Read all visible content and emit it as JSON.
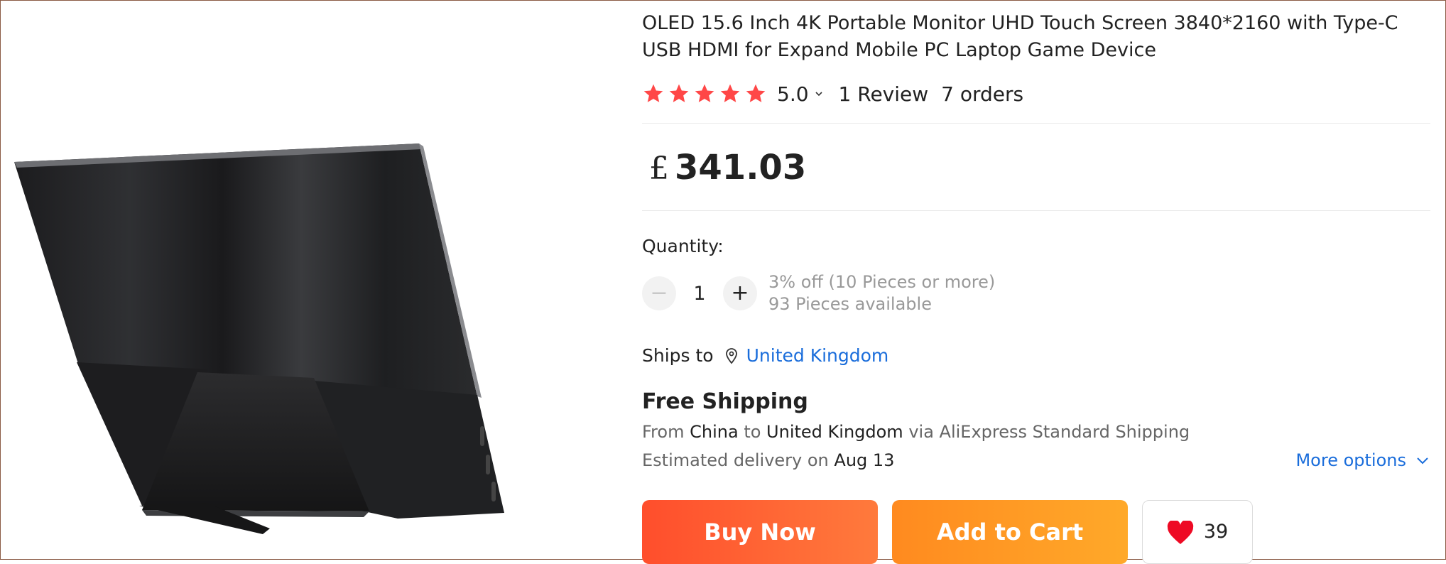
{
  "product": {
    "title": "OLED 15.6 Inch 4K Portable Monitor UHD Touch Screen 3840*2160 with Type-C USB HDMI for Expand Mobile PC Laptop Game Device",
    "image_alt": "portable monitor with kickstand"
  },
  "rating": {
    "stars": 5,
    "score": "5.0",
    "reviews": "1 Review",
    "orders": "7 orders",
    "star_color": "#ff4747"
  },
  "price": {
    "currency": "£",
    "amount": "341.03"
  },
  "quantity": {
    "label": "Quantity:",
    "value": "1",
    "minus": "−",
    "plus": "+",
    "discount": "3% off (10 Pieces or more)",
    "available": "93 Pieces available"
  },
  "ships_to": {
    "label": "Ships to",
    "country": "United Kingdom"
  },
  "shipping": {
    "title": "Free Shipping",
    "from_label": "From",
    "from": "China",
    "to_label": "to",
    "to": "United Kingdom",
    "via": "via AliExpress Standard Shipping",
    "estimated_label": "Estimated delivery on",
    "estimated_date": "Aug 13",
    "more_options": "More options"
  },
  "actions": {
    "buy_now": "Buy Now",
    "add_to_cart": "Add to Cart",
    "wishlist_count": "39"
  },
  "colors": {
    "link": "#1a6ddb",
    "buy": "#ff4e2c",
    "cart": "#ff9a22",
    "heart": "#ee0a24"
  }
}
